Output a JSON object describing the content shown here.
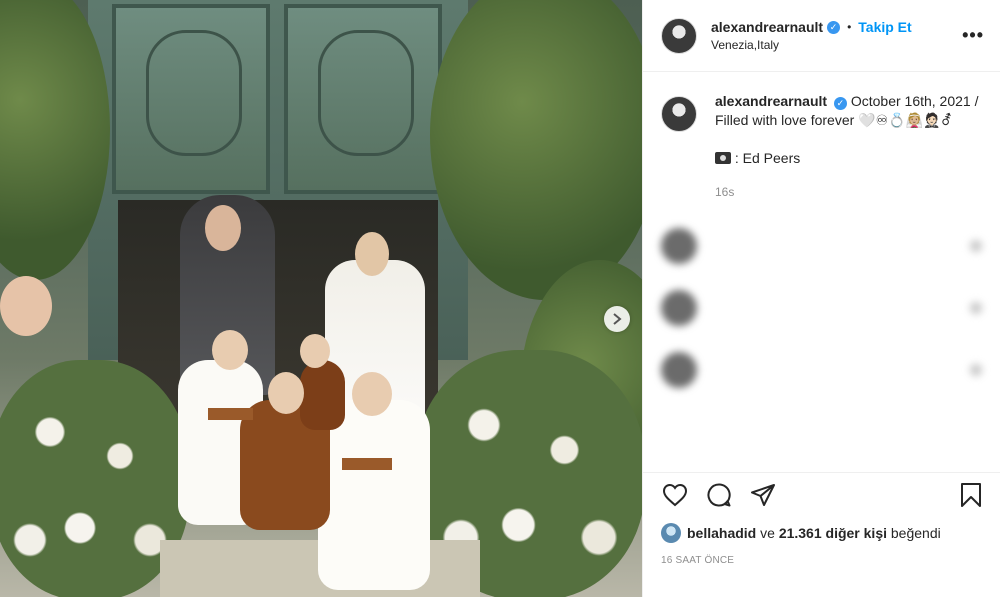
{
  "post": {
    "username": "alexandrearnault",
    "separator": "•",
    "follow_label": "Takip Et",
    "location": "Venezia,Italy",
    "more_label": "•••"
  },
  "caption": {
    "username": "alexandrearnault",
    "text": "October 16th, 2021 / Filled with love forever 🤍♾💍👰🏼🤵🏻⚦",
    "credit": ": Ed Peers",
    "time": "16s"
  },
  "comments": [
    {
      "username": "",
      "text": "",
      "hearts": ""
    },
    {
      "username": "",
      "text": "",
      "hearts": ""
    },
    {
      "username": "",
      "text": "",
      "hearts": ""
    }
  ],
  "media": {
    "next_icon": "chevron-right-icon"
  },
  "actions": {
    "like_icon": "heart-icon",
    "comment_icon": "comment-icon",
    "share_icon": "share-icon",
    "save_icon": "bookmark-icon"
  },
  "likes": {
    "first_user": "bellahadid",
    "connector": "ve",
    "count_text": "21.361 diğer kişi",
    "suffix": "beğendi"
  },
  "timestamp": "16 SAAT ÖNCE",
  "colors": {
    "accent": "#0095f6",
    "verified": "#3897f0",
    "muted": "#8e8e8e",
    "heart": "#ed4956"
  }
}
